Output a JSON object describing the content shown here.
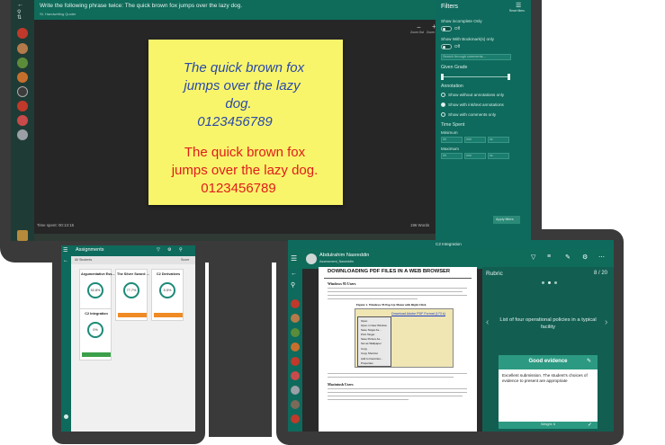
{
  "monitor": {
    "prompt_title": "Write the following phrase twice: The quick brown fox jumps over the lazy dog.",
    "student_name": "St. Handwriting Quoter",
    "zoom_out_label": "Zoom Out",
    "zoom_in_label": "Zoom In",
    "status_left": "Time spent: 00:13:15",
    "status_right": "196 Words",
    "handwriting": {
      "ink_lines": [
        "The quick brown fox",
        "jumps over the lazy",
        "dog.",
        "0123456789"
      ],
      "print_lines": [
        "The quick brown fox",
        "jumps over the lazy dog.",
        "0123456789"
      ]
    },
    "filters": {
      "title": "Filters",
      "reset_label": "Reset filters",
      "incomplete_label": "Show incomplete Only",
      "incomplete_state": "Off",
      "bookmarks_label": "Show With Bookmark(s) only",
      "bookmarks_state": "Off",
      "search_placeholder": "Search through comments...",
      "grade_label": "Given Grade",
      "annotation_label": "Annotation",
      "annotation_options": [
        "Show without annotations only",
        "Show with ink/text annotations",
        "Show with comments only"
      ],
      "time_label": "Time Spent",
      "min_label": "Minimum",
      "max_label": "Maximum",
      "hh": "hh",
      "mm": "mm",
      "ss": "ss",
      "apply_label": "Apply filters"
    }
  },
  "phone": {
    "title": "Assignments",
    "filter_label": "All Students",
    "sort_label": "Score",
    "cards": [
      {
        "title": "Argumentative Ess...",
        "value": "52.8%"
      },
      {
        "title": "The Silver Sword: ...",
        "value": "77.7%"
      },
      {
        "title": "C2 Derivatives",
        "value": "5.5%"
      },
      {
        "title": "C2 Integration",
        "value": "0%"
      }
    ],
    "due_labels": [
      "Due 14.02.2018 10:00",
      "Due 14.02.2018 10:00",
      "Due 14.02.2018 10:00",
      "Due 14.02.2018 10:00"
    ]
  },
  "tablet": {
    "app_title": "C2 Integration",
    "student_name": "Abdulrahim Nasreddin",
    "student_sub": "Assessment_Nasreddin",
    "doc_title": "DOWNLOADING PDF FILES IN A WEB BROWSER",
    "doc_section": "Windows 95 Users",
    "doc_section2": "Macintosh Users",
    "doc_figure": "Figure 1. Windows 95 Pop-Up Menu with Right Click",
    "doc_link": "Download Adobe PDF Format (173 k)",
    "context_menu": [
      "Open",
      "Open in New Window",
      "Save Target As...",
      "Print Target",
      "Save Picture As...",
      "Set as Wallpaper",
      "Copy",
      "Copy Shortcut",
      "Add to Favorites...",
      "Properties"
    ],
    "rubric_label": "Rubric",
    "rubric_page": "8 / 20",
    "criterion": "List of four operational policies in a typical facility",
    "level": "Good evidence",
    "level_desc": "Excellent submission. The student's choices of evidence to present are appropriate",
    "footer": "Weight: 6"
  },
  "colors": {
    "teal": "#0e6a5c",
    "teal_dark": "#0a4d42",
    "sticky": "#f9f56a",
    "ink_blue": "#2a4aa8",
    "ink_red": "#e01c1c",
    "due_green": "#3ca04a",
    "due_orange": "#f08a24"
  }
}
